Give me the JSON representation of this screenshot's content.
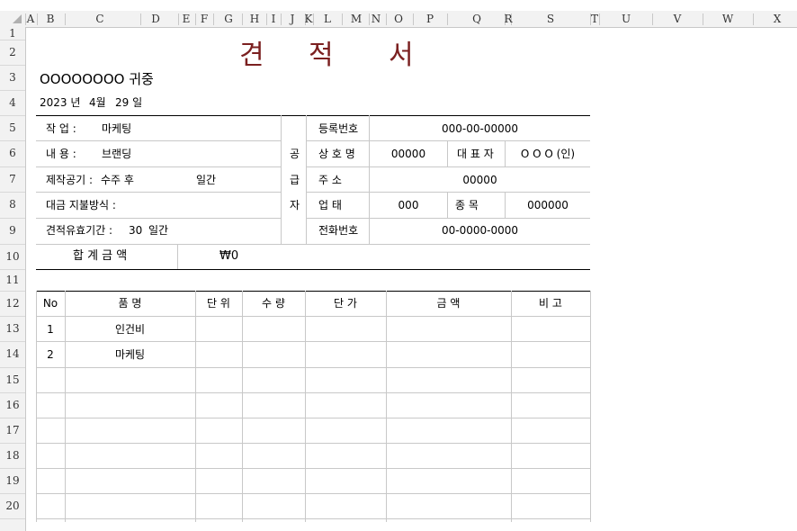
{
  "colors": {
    "title": "#7b2020",
    "gridline": "#c8c8c8",
    "header_bg": "#f2f2f2"
  },
  "columns": [
    "A",
    "B",
    "C",
    "D",
    "E",
    "F",
    "G",
    "H",
    "I",
    "J",
    "K",
    "L",
    "M",
    "N",
    "O",
    "P",
    "Q",
    "R",
    "S",
    "T",
    "U",
    "V",
    "W",
    "X"
  ],
  "rows": [
    "1",
    "2",
    "3",
    "4",
    "5",
    "6",
    "7",
    "8",
    "9",
    "10",
    "11",
    "12",
    "13",
    "14",
    "15",
    "16",
    "17",
    "18",
    "19",
    "20"
  ],
  "doc": {
    "title_chars": [
      "견",
      "적",
      "서"
    ],
    "recipient": "OOOOOOOO 귀중",
    "date": {
      "year": "2023 년",
      "month": "4월",
      "day": "29 일"
    }
  },
  "left_info": {
    "job_label": "작    업  :",
    "job_value": "마케팅",
    "content_label": "내    용  :",
    "content_value": "브랜딩",
    "period_label": "제작공기 :",
    "period_value": "수주 후",
    "period_unit": "일간",
    "payment_label": "대금 지불방식 :",
    "validity_label": "견적유효기간 :",
    "validity_value": "30",
    "validity_unit": "일간"
  },
  "supplier": {
    "vertical_chars": [
      "공",
      "급",
      "자"
    ],
    "reg_label": "등록번호",
    "reg_value": "000-00-00000",
    "company_label": "상 호 명",
    "company_value": "00000",
    "rep_label": "대 표 자",
    "rep_value": "O O O  (인)",
    "address_label": "주       소",
    "address_value": "00000",
    "biz_type_label": "업       태",
    "biz_type_value": "000",
    "biz_item_label": "종       목",
    "biz_item_value": "000000",
    "phone_label": "전화번호",
    "phone_value": "00-0000-0000"
  },
  "total": {
    "label": "합 계 금 액",
    "value": "₩0"
  },
  "table": {
    "headers": [
      "No",
      "품            명",
      "단    위",
      "수    량",
      "단        가",
      "금                    액",
      "비        고"
    ],
    "rows": [
      {
        "no": "1",
        "item": "인건비"
      },
      {
        "no": "2",
        "item": "마케팅"
      }
    ]
  }
}
